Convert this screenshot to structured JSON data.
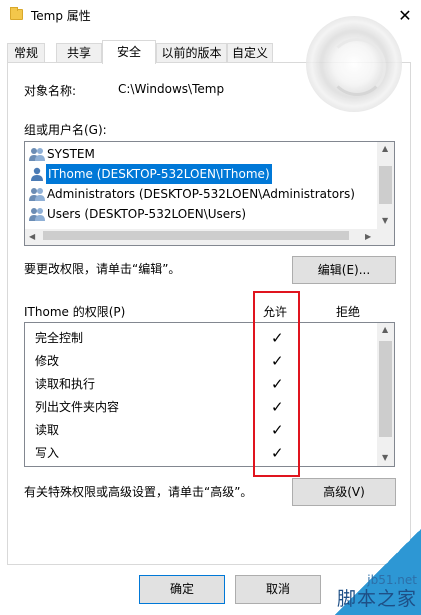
{
  "window": {
    "title": "Temp 属性",
    "close_glyph": "✕"
  },
  "tabs": [
    {
      "label": "常规",
      "active": false
    },
    {
      "label": "共享",
      "active": false
    },
    {
      "label": "安全",
      "active": true
    },
    {
      "label": "以前的版本",
      "active": false
    },
    {
      "label": "自定义",
      "active": false
    }
  ],
  "security": {
    "object_label": "对象名称:",
    "object_value": "C:\\Windows\\Temp",
    "group_label": "组或用户名(G):",
    "users": [
      {
        "name": "SYSTEM",
        "icon": "user-group-icon",
        "selected": false
      },
      {
        "name": "IThome (DESKTOP-532LOEN\\IThome)",
        "icon": "user-icon",
        "selected": true
      },
      {
        "name": "Administrators (DESKTOP-532LOEN\\Administrators)",
        "icon": "user-group-icon",
        "selected": false
      },
      {
        "name": "Users (DESKTOP-532LOEN\\Users)",
        "icon": "user-group-icon",
        "selected": false
      }
    ],
    "edit_hint": "要更改权限，请单击“编辑”。",
    "edit_button": "编辑(E)...",
    "perm_title": "IThome 的权限(P)",
    "col_allow": "允许",
    "col_deny": "拒绝",
    "permissions": [
      {
        "name": "完全控制",
        "allow": true,
        "deny": false
      },
      {
        "name": "修改",
        "allow": true,
        "deny": false
      },
      {
        "name": "读取和执行",
        "allow": true,
        "deny": false
      },
      {
        "name": "列出文件夹内容",
        "allow": true,
        "deny": false
      },
      {
        "name": "读取",
        "allow": true,
        "deny": false
      },
      {
        "name": "写入",
        "allow": true,
        "deny": false
      }
    ],
    "check_glyph": "✓",
    "advanced_hint": "有关特殊权限或高级设置，请单击“高级”。",
    "advanced_button": "高级(V)"
  },
  "footer": {
    "ok_button": "确定",
    "cancel_button": "取消"
  },
  "watermark": {
    "site": "jb51.net",
    "brand": "脚本之家"
  },
  "colors": {
    "selection": "#0078d7",
    "highlight_box": "#e0141e",
    "watermark": "#2d97d4"
  }
}
